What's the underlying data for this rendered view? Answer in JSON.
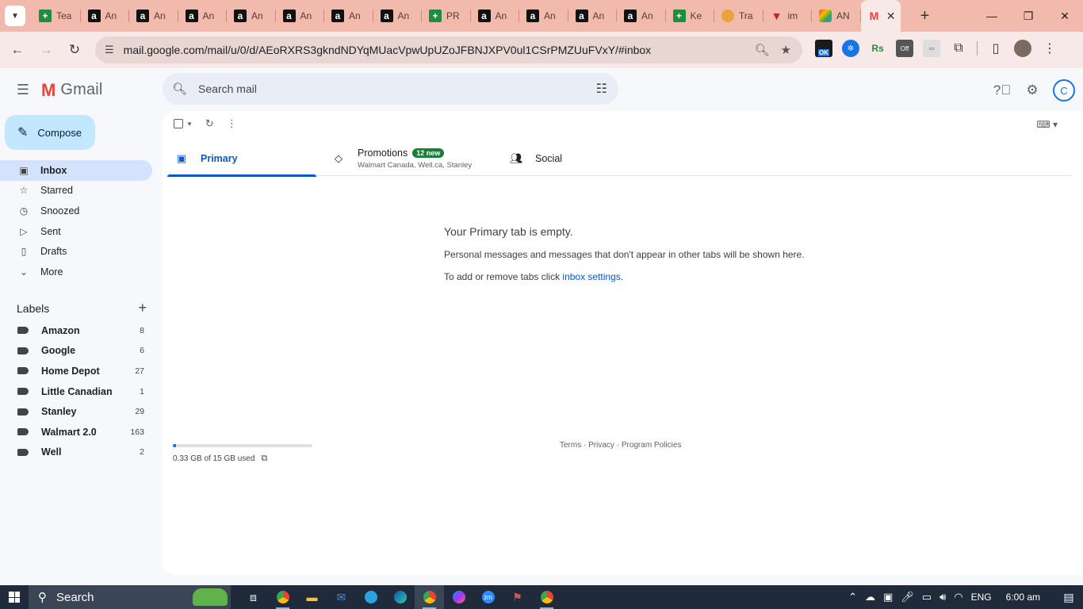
{
  "browser": {
    "tabs": [
      {
        "label": "Tea",
        "favicon": "sheets-icon"
      },
      {
        "label": "An",
        "favicon": "amazon-icon"
      },
      {
        "label": "An",
        "favicon": "amazon-icon"
      },
      {
        "label": "An",
        "favicon": "amazon-icon"
      },
      {
        "label": "An",
        "favicon": "amazon-icon"
      },
      {
        "label": "An",
        "favicon": "amazon-icon"
      },
      {
        "label": "An",
        "favicon": "amazon-icon"
      },
      {
        "label": "An",
        "favicon": "amazon-icon"
      },
      {
        "label": "PR",
        "favicon": "sheets-icon"
      },
      {
        "label": "An",
        "favicon": "amazon-icon"
      },
      {
        "label": "An",
        "favicon": "amazon-icon"
      },
      {
        "label": "An",
        "favicon": "amazon-icon"
      },
      {
        "label": "An",
        "favicon": "amazon-icon"
      },
      {
        "label": "Ke",
        "favicon": "sheets-icon"
      },
      {
        "label": "Tra",
        "favicon": "taco-icon"
      },
      {
        "label": "im",
        "favicon": "red-icon"
      },
      {
        "label": "AN",
        "favicon": "multicolor-icon"
      }
    ],
    "url": "mail.google.com/mail/u/0/d/AEoRXRS3gkndNDYqMUacVpwUpUZoJFBNJXPV0ul1CSrPMZUuFVxY/#inbox",
    "ext_ok_badge": "OK",
    "ext_rs_label": "Rs",
    "ext_off_label": "Off"
  },
  "gmail": {
    "logo_text": "Gmail",
    "search_placeholder": "Search mail",
    "account_initial": "C",
    "compose_label": "Compose",
    "nav": [
      {
        "label": "Inbox",
        "icon": "inbox-icon",
        "active": true
      },
      {
        "label": "Starred",
        "icon": "star-icon"
      },
      {
        "label": "Snoozed",
        "icon": "clock-icon"
      },
      {
        "label": "Sent",
        "icon": "send-icon"
      },
      {
        "label": "Drafts",
        "icon": "draft-icon"
      },
      {
        "label": "More",
        "icon": "chevron-down-icon"
      }
    ],
    "labels_heading": "Labels",
    "labels": [
      {
        "name": "Amazon",
        "count": "8"
      },
      {
        "name": "Google",
        "count": "6"
      },
      {
        "name": "Home Depot",
        "count": "27"
      },
      {
        "name": "Little Canadian",
        "count": "1"
      },
      {
        "name": "Stanley",
        "count": "29"
      },
      {
        "name": "Walmart 2.0",
        "count": "163"
      },
      {
        "name": "Well",
        "count": "2"
      }
    ],
    "tabs": {
      "primary": "Primary",
      "promotions": "Promotions",
      "promotions_badge": "12 new",
      "promotions_sub": "Walmart Canada, Well.ca, Stanley",
      "social": "Social"
    },
    "empty_state": {
      "title": "Your Primary tab is empty.",
      "line1": "Personal messages and messages that don't appear in other tabs will be shown here.",
      "line2_prefix": "To add or remove tabs click ",
      "line2_link": "inbox settings",
      "line2_suffix": "."
    },
    "storage": {
      "text": "0.33 GB of 15 GB used",
      "used_fraction": 0.022
    },
    "footer": {
      "terms": "Terms",
      "sep1": " · ",
      "privacy": "Privacy",
      "sep2": " · ",
      "program": "Program Policies"
    }
  },
  "taskbar": {
    "search_label": "Search",
    "lang": "ENG",
    "time": "6:00 am",
    "zoom_label": "zm"
  },
  "colors": {
    "tabstrip": "#f2b9ad",
    "compose_bg": "#c2e7ff",
    "active_nav": "#d3e3fd",
    "accent": "#0b57d0",
    "badge": "#188038"
  }
}
